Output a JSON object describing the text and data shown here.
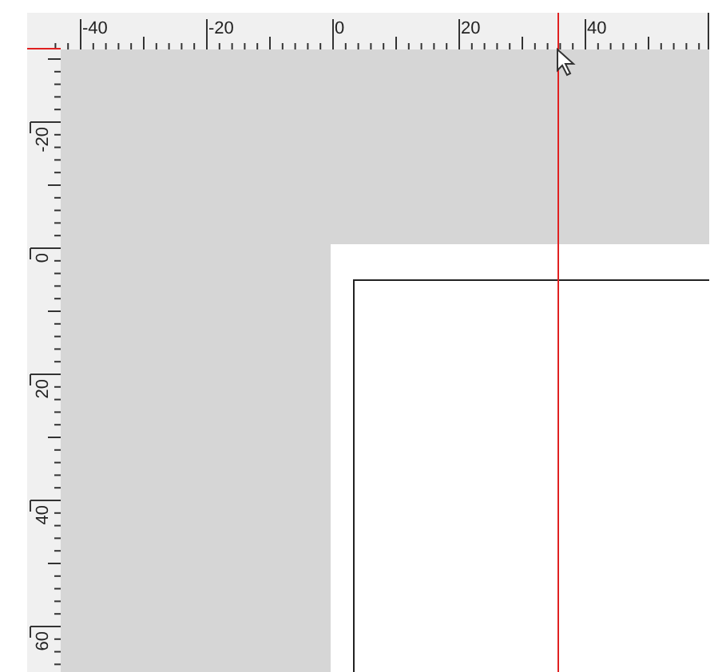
{
  "horizontal_ruler": {
    "labels": [
      "-40",
      "-20",
      "0",
      "20",
      "40"
    ]
  },
  "vertical_ruler": {
    "labels": [
      "-20",
      "0",
      "20",
      "40",
      "60"
    ]
  }
}
